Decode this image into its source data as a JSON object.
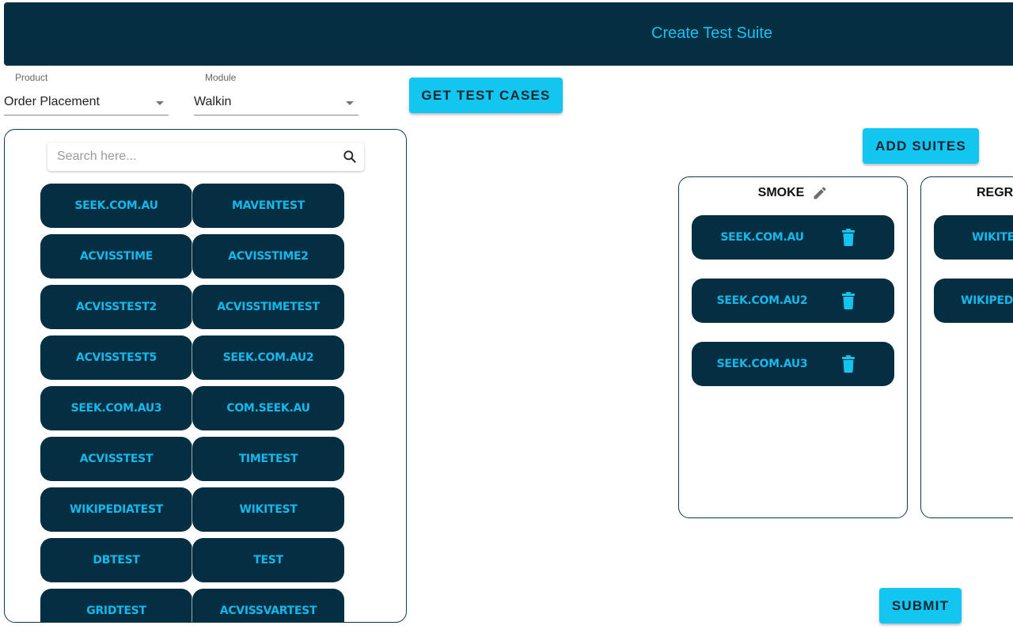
{
  "header": {
    "title": "Create Test Suite"
  },
  "filters": {
    "product": {
      "label": "Product",
      "value": "Order Placement"
    },
    "module": {
      "label": "Module",
      "value": "Walkin"
    }
  },
  "buttons": {
    "get_test_cases": "GET TEST CASES",
    "add_suites": "ADD SUITES",
    "submit": "SUBMIT"
  },
  "search": {
    "placeholder": "Search here...",
    "value": "",
    "icon": "search-icon"
  },
  "test_cases": [
    "SEEK.COM.AU",
    "MAVENTEST",
    "ACVISSTIME",
    "ACVISSTIME2",
    "ACVISSTEST2",
    "ACVISSTIMETEST",
    "ACVISSTEST5",
    "SEEK.COM.AU2",
    "SEEK.COM.AU3",
    "COM.SEEK.AU",
    "ACVISSTEST",
    "TIMETEST",
    "WIKIPEDIATEST",
    "WIKITEST",
    "DBTEST",
    "TEST",
    "GRIDTEST",
    "ACVISSVARTEST"
  ],
  "suites": [
    {
      "name": "SMOKE",
      "edit_icon": "pencil-icon",
      "items": [
        "SEEK.COM.AU",
        "SEEK.COM.AU2",
        "SEEK.COM.AU3"
      ],
      "item_icon": "trash-icon"
    },
    {
      "name": "REGR",
      "items": [
        "WIKITE",
        "WIKIPEDI"
      ]
    }
  ],
  "colors": {
    "header_bg": "#042e41",
    "accent": "#13c6ef",
    "pill_bg": "#042e41",
    "pill_text": "#14b8ea"
  }
}
